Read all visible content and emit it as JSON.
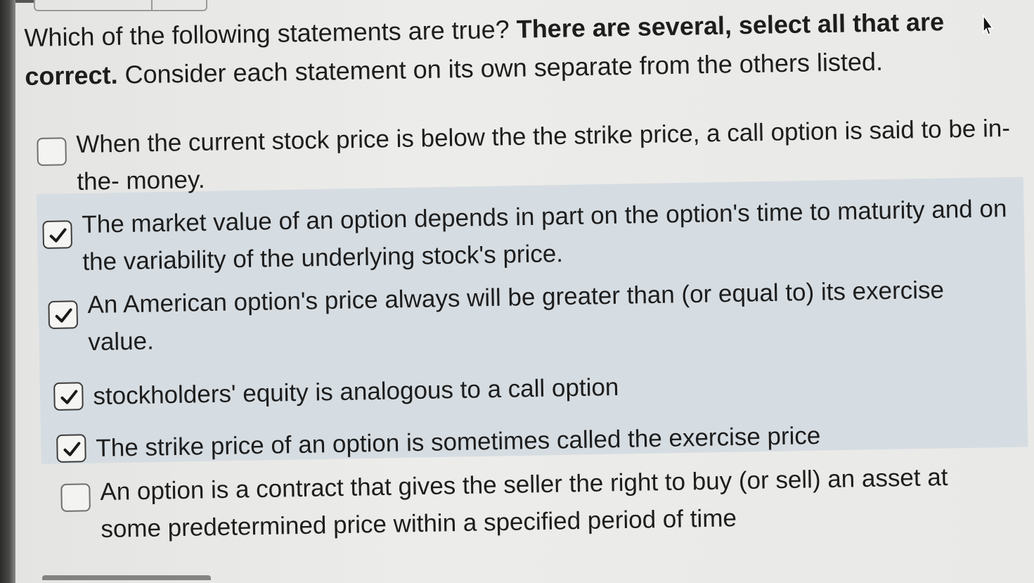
{
  "question": {
    "part1": "Which of the following statements are true? ",
    "bold": "There are several, select all that are correct.",
    "part2": " Consider each statement on its own separate from the others listed."
  },
  "choices": [
    {
      "text": "When the current stock price is below the the strike price, a call option is said to be in-the- money.",
      "checked": false
    },
    {
      "text": "The market value of an option depends in part on the option's time to maturity and on the variability of the underlying stock's price.",
      "checked": true
    },
    {
      "text": "An American option's price always will be greater than (or equal to) its exercise value.",
      "checked": true
    },
    {
      "text": "stockholders' equity is analogous to a call option",
      "checked": true
    },
    {
      "text": "The strike price of an option is sometimes called the exercise price",
      "checked": true
    },
    {
      "text": "An option is a contract that gives the seller the right to buy (or sell) an asset at some predetermined price within a specified period of time",
      "checked": false
    }
  ],
  "icons": {
    "checkmark": "checkmark-icon",
    "cursor": "mouse-cursor-icon"
  },
  "colors": {
    "highlight": "#d6dde2",
    "checkbox_border": "#6f6f6f"
  }
}
